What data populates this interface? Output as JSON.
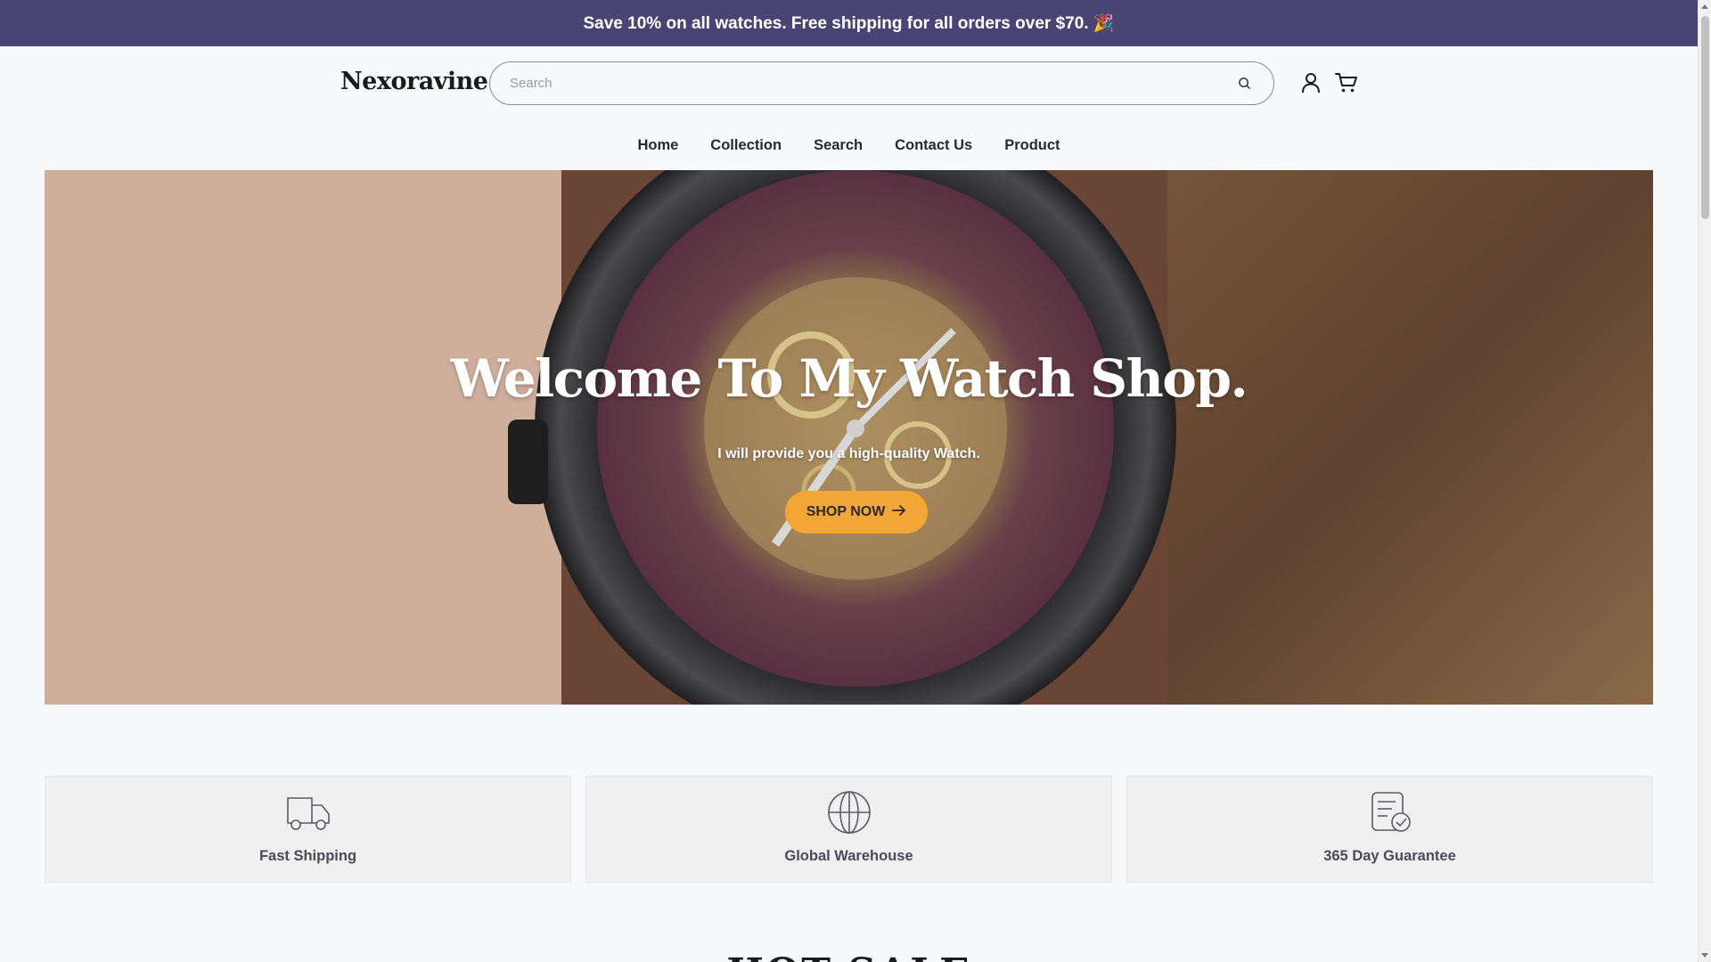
{
  "announcement": {
    "text": "Save 10% on all watches. Free shipping for all orders over $70. 🎉"
  },
  "header": {
    "logo": "Nexoravine",
    "search": {
      "placeholder": "Search",
      "value": ""
    },
    "icons": {
      "account": "user-icon",
      "cart": "cart-icon",
      "search": "search-icon"
    }
  },
  "nav": {
    "items": [
      {
        "label": "Home"
      },
      {
        "label": "Collection"
      },
      {
        "label": "Search"
      },
      {
        "label": "Contact Us"
      },
      {
        "label": "Product"
      }
    ]
  },
  "hero": {
    "title": "Welcome To My Watch Shop.",
    "subtitle": "I will provide you a high-quality Watch.",
    "button_label": "SHOP NOW",
    "button_color": "#f3a535"
  },
  "features": [
    {
      "label": "Fast Shipping",
      "icon": "truck-icon"
    },
    {
      "label": "Global Warehouse",
      "icon": "globe-icon"
    },
    {
      "label": "365 Day Guarantee",
      "icon": "guarantee-icon"
    }
  ],
  "section": {
    "title": "HOT SALE"
  },
  "colors": {
    "announcement_bg": "#4a4474",
    "accent": "#f3a535",
    "page_bg": "#f8f9fb"
  }
}
